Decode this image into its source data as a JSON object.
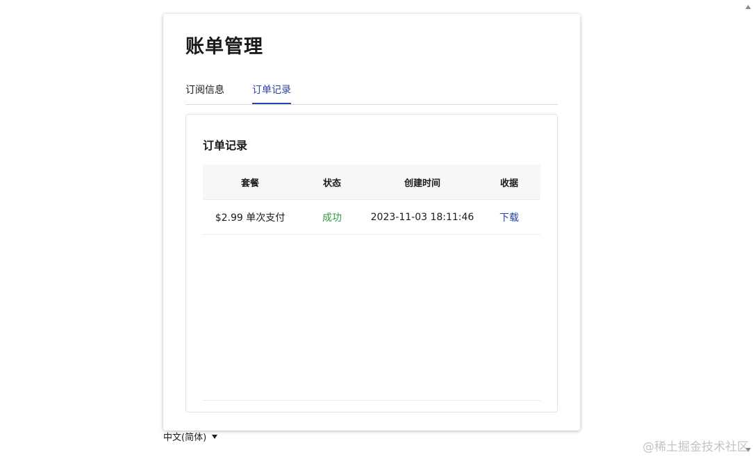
{
  "page": {
    "title": "账单管理"
  },
  "tabs": [
    {
      "label": "订阅信息",
      "active": false
    },
    {
      "label": "订单记录",
      "active": true
    }
  ],
  "orders": {
    "title": "订单记录",
    "columns": [
      "套餐",
      "状态",
      "创建时间",
      "收据"
    ],
    "rows": [
      {
        "plan": "$2.99 单次支付",
        "status": "成功",
        "created": "2023-11-03 18:11:46",
        "receipt": "下载"
      }
    ]
  },
  "language": {
    "selected": "中文(简体)"
  },
  "watermark": "@稀土掘金技术社区",
  "colors": {
    "accent": "#2444a8",
    "success": "#2d9e3d"
  },
  "icons": {
    "language_dropdown": "caret-down-icon",
    "scroll_up": "scroll-up-arrow-icon",
    "scroll_down": "scroll-down-arrow-icon"
  }
}
